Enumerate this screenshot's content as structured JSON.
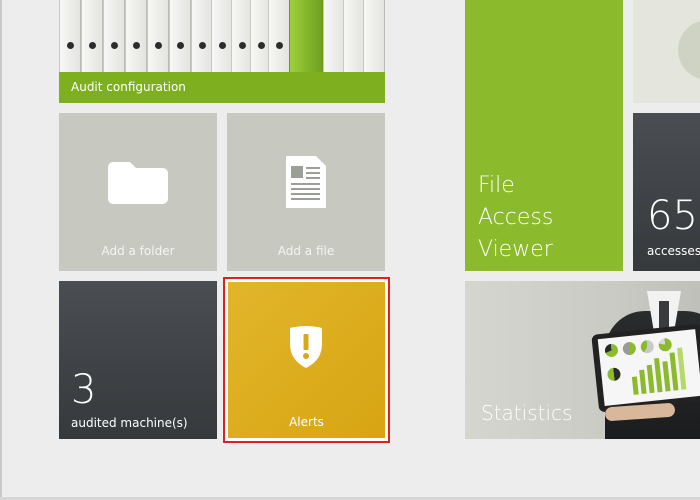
{
  "tiles": {
    "audit": {
      "label": "Audit configuration"
    },
    "folder": {
      "label": "Add a folder"
    },
    "file": {
      "label": "Add a file"
    },
    "machines": {
      "count": "3",
      "label": "audited machine(s)"
    },
    "alerts": {
      "label": "Alerts"
    },
    "file_access_viewer": {
      "lines": [
        "File",
        "Access",
        "Viewer"
      ]
    },
    "accesses": {
      "count": "65",
      "label": "accesses"
    },
    "statistics": {
      "label": "Statistics"
    }
  },
  "colors": {
    "green": "#8cba2d",
    "audit_bar": "#7daf1f",
    "alerts": "#d9a817",
    "dark_tile": "#3e4245",
    "grey_tile": "#c7c9c1",
    "selection_border": "#e0201f"
  },
  "icons": {
    "folder": "folder-icon",
    "file": "document-icon",
    "alerts": "shield-alert-icon"
  }
}
